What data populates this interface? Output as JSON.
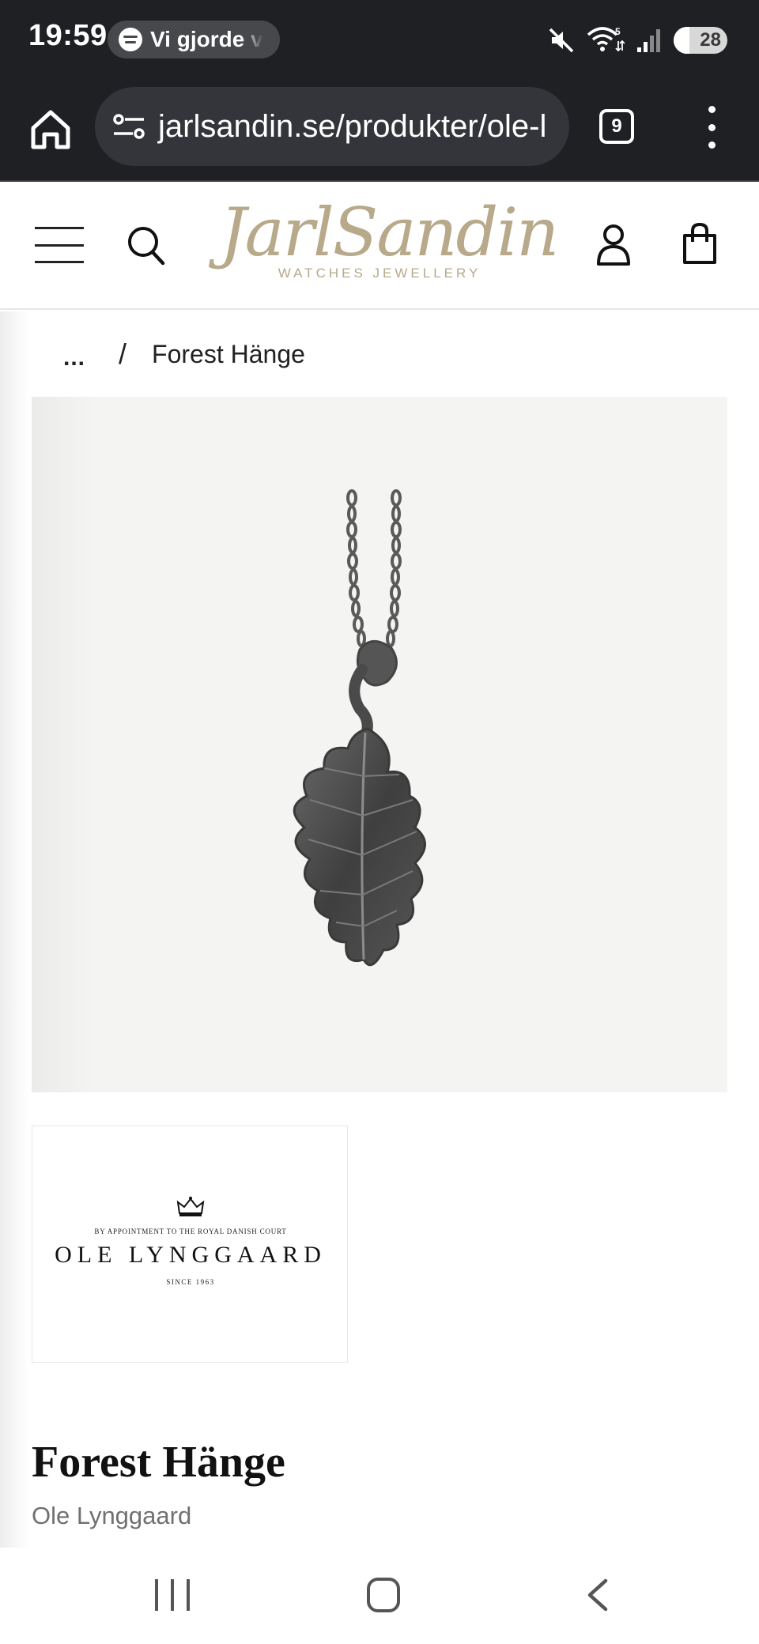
{
  "status_bar": {
    "time": "19:59",
    "media_app_icon": "spotify-icon",
    "media_text": "Vi gjorde v",
    "icons": [
      "mute-icon",
      "wifi-icon",
      "signal-icon"
    ],
    "wifi_badge": "5",
    "battery_level": "28"
  },
  "browser": {
    "url": "jarlsandin.se/produkter/ole-l",
    "tab_count": "9",
    "icons": [
      "home-icon",
      "site-settings-icon",
      "tabs-icon",
      "more-vert-icon"
    ]
  },
  "site_header": {
    "logo_script": "JarlSandin",
    "logo_subtitle": "WATCHES   JEWELLERY",
    "logo_color": "#b7a98a",
    "icons": [
      "menu-icon",
      "search-icon",
      "account-icon",
      "shopping-bag-icon"
    ]
  },
  "breadcrumb": {
    "ellipsis": "...",
    "separator": "/",
    "current": "Forest Hänge"
  },
  "gallery": {
    "main_image": "oak-leaf-pendant-on-chain",
    "thumbnail": {
      "appointment": "BY APPOINTMENT TO THE ROYAL DANISH COURT",
      "brand_name": "OLE LYNGGAARD",
      "since": "SINCE 1963"
    }
  },
  "product": {
    "title": "Forest Hänge",
    "brand": "Ole Lynggaard"
  },
  "nav_bar": {
    "icons": [
      "recent-apps-icon",
      "home-circle-icon",
      "back-icon"
    ]
  }
}
